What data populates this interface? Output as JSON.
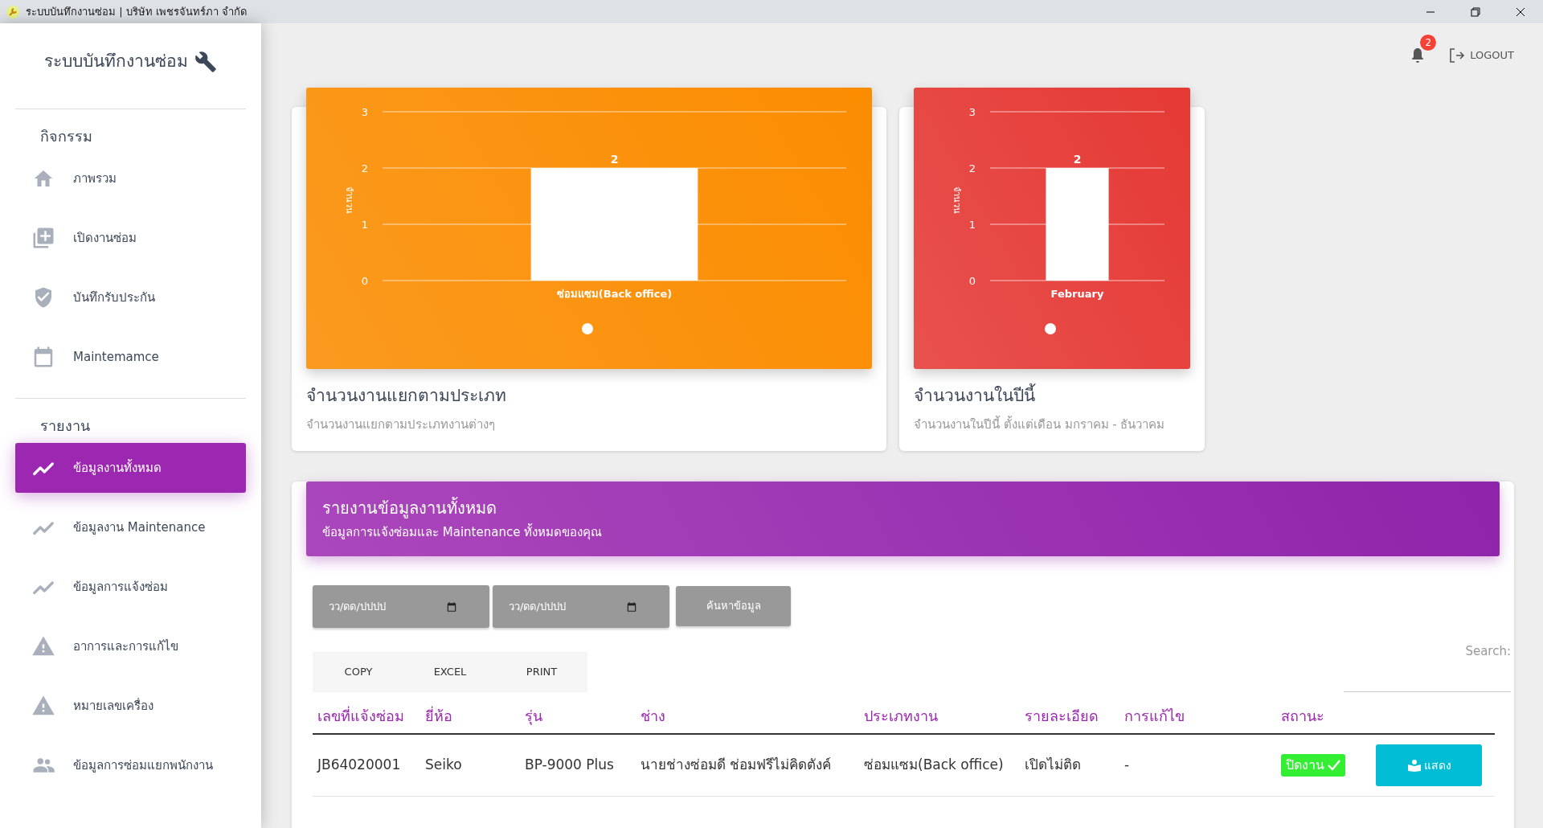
{
  "window": {
    "title": "ระบบบันทึกงานซ่อม | บริษัท เพชรจันทร์ภา จำกัด"
  },
  "sidebar": {
    "brand": "ระบบบันทึกงานซ่อม",
    "sections": [
      {
        "heading": "กิจกรรม",
        "items": [
          {
            "label": "ภาพรวม",
            "kind": "home",
            "selected": false
          },
          {
            "label": "เปิดงานซ่อม",
            "kind": "add",
            "selected": false
          },
          {
            "label": "บันทึกรับประกัน",
            "kind": "shield",
            "selected": false
          },
          {
            "label": "Maintemamce",
            "kind": "calendar",
            "selected": false
          }
        ]
      },
      {
        "heading": "รายงาน",
        "items": [
          {
            "label": "ข้อมูลงานทั้งหมด",
            "kind": "trend",
            "selected": true
          },
          {
            "label": "ข้อมูลงาน Maintenance",
            "kind": "trend",
            "selected": false
          },
          {
            "label": "ข้อมูลการแจ้งซ่อม",
            "kind": "trend",
            "selected": false
          },
          {
            "label": "อาการและการแก้ไข",
            "kind": "warning",
            "selected": false
          },
          {
            "label": "หมายเลขเครื่อง",
            "kind": "warning",
            "selected": false
          },
          {
            "label": "ข้อมูลการซ่อมแยกพนักงาน",
            "kind": "people",
            "selected": false
          }
        ]
      }
    ]
  },
  "topbar": {
    "notification_count": "2",
    "logout": "LOGOUT"
  },
  "cards": [
    {
      "title": "จำนวนงานแยกตามประเภท",
      "subtitle": "จำนวนงานแยกตามประเภทงานต่างๆ",
      "color": "#fb8c00",
      "chart_data": {
        "type": "bar",
        "ylabel": "จำนวน",
        "categories": [
          "ซ่อมแซม(Back office)"
        ],
        "values": [
          2
        ],
        "ylim": [
          0,
          3
        ],
        "yticks": [
          0,
          1,
          2,
          3
        ],
        "data_labels": true
      }
    },
    {
      "title": "จำนวนงานในปีนี้",
      "subtitle": "จำนวนงานในปีนี้ ตั้งแต่เดือน มกราคม - ธันวาคม",
      "color": "#e53935",
      "chart_data": {
        "type": "bar",
        "ylabel": "จำนวน",
        "categories": [
          "February"
        ],
        "values": [
          2
        ],
        "ylim": [
          0,
          3
        ],
        "yticks": [
          0,
          1,
          2,
          3
        ],
        "data_labels": true
      }
    }
  ],
  "report": {
    "title": "รายงานข้อมูลงานทั้งหมด",
    "subtitle": "ข้อมูลการแจ้งซ่อมและ Maintenance ทั้งหมดของคุณ",
    "date_from": {
      "placeholder": "วว/ดด/ปปปป"
    },
    "date_to": {
      "placeholder": "วว/ดด/ปปปป"
    },
    "search_button": "ค้นหาข้อมูล",
    "export_buttons": [
      "COPY",
      "EXCEL",
      "PRINT"
    ],
    "search_label": "Search:",
    "table": {
      "columns": [
        "เลขที่แจ้งซ่อม",
        "ยี่ห้อ",
        "รุ่น",
        "ช่าง",
        "ประเภทงาน",
        "รายละเอียด",
        "การแก้ไข",
        "สถานะ"
      ],
      "rows": [
        {
          "cells": [
            "JB64020001",
            "Seiko",
            "BP-9000 Plus",
            "นายช่างซ่อมดี ช่อมฟรีไม่คิดตังค์",
            "ซ่อมแซม(Back office)",
            "เปิดไม่ติด",
            "-"
          ],
          "status": "ปิดงาน",
          "action": "แสดง"
        }
      ]
    }
  }
}
